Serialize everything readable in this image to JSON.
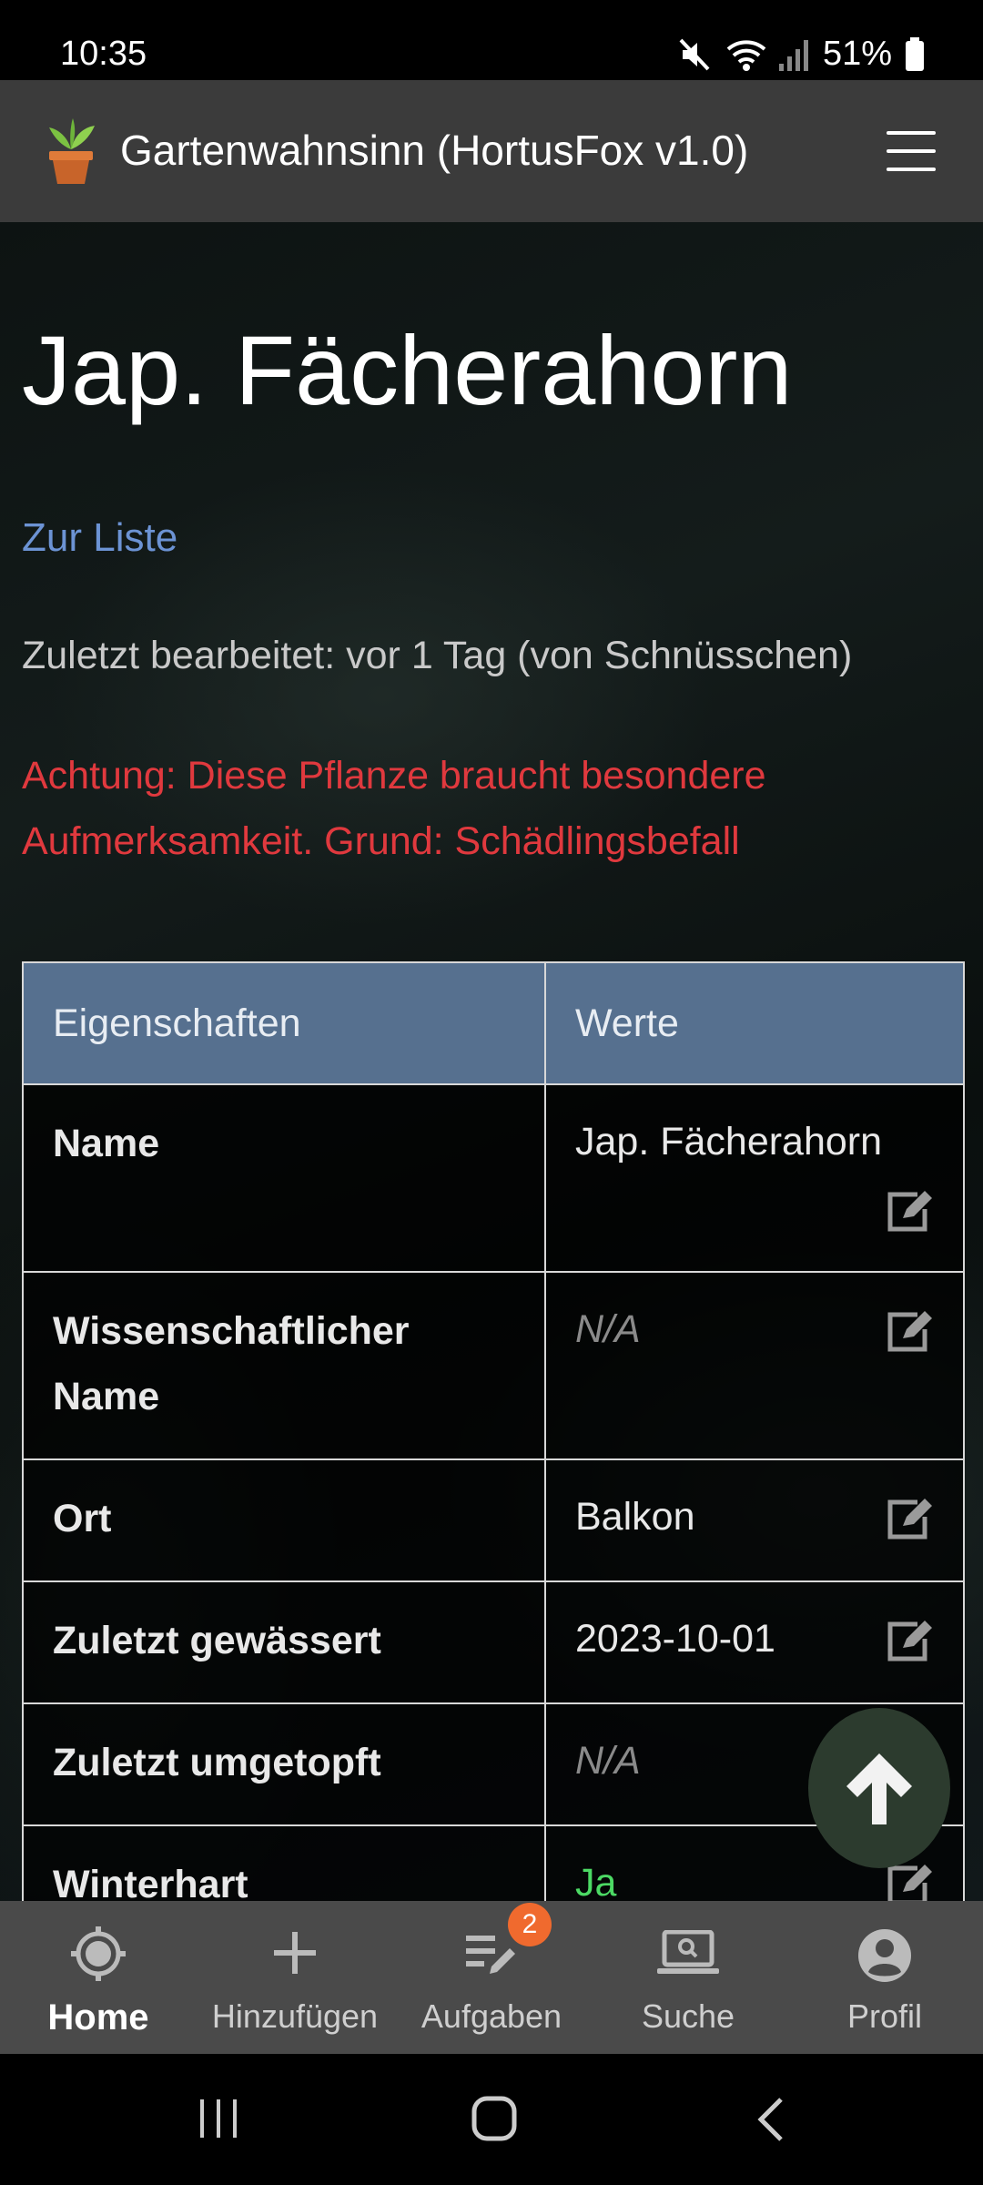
{
  "status": {
    "time": "10:35",
    "battery": "51%"
  },
  "app": {
    "title": "Gartenwahnsinn (HortusFox v1.0)"
  },
  "page": {
    "title": "Jap. Fächerahorn",
    "back_link": "Zur Liste",
    "edited": "Zuletzt bearbeitet: vor 1 Tag (von Schnüsschen)",
    "warning": "Achtung: Diese Pflanze braucht besondere Aufmerksamkeit. Grund: Schädlingsbefall"
  },
  "table": {
    "headers": [
      "Eigenschaften",
      "Werte"
    ],
    "rows": [
      {
        "prop": "Name",
        "value": "Jap. Fächerahorn"
      },
      {
        "prop": "Wissenschaftlicher Name",
        "value": "N/A"
      },
      {
        "prop": "Ort",
        "value": "Balkon"
      },
      {
        "prop": "Zuletzt gewässert",
        "value": "2023-10-01"
      },
      {
        "prop": "Zuletzt umgetopft",
        "value": "N/A"
      },
      {
        "prop": "Winterhart",
        "value": "Ja"
      }
    ]
  },
  "nav": {
    "items": [
      {
        "label": "Home",
        "icon": "home-target-icon",
        "active": true
      },
      {
        "label": "Hinzufügen",
        "icon": "plus-icon"
      },
      {
        "label": "Aufgaben",
        "icon": "tasks-edit-icon",
        "badge": "2"
      },
      {
        "label": "Suche",
        "icon": "laptop-search-icon"
      },
      {
        "label": "Profil",
        "icon": "user-icon"
      }
    ]
  },
  "colors": {
    "accent_link": "#6c93d4",
    "warning": "#e0393e",
    "table_header": "#56708f",
    "yes": "#4cd964",
    "badge": "#f06a2e"
  }
}
